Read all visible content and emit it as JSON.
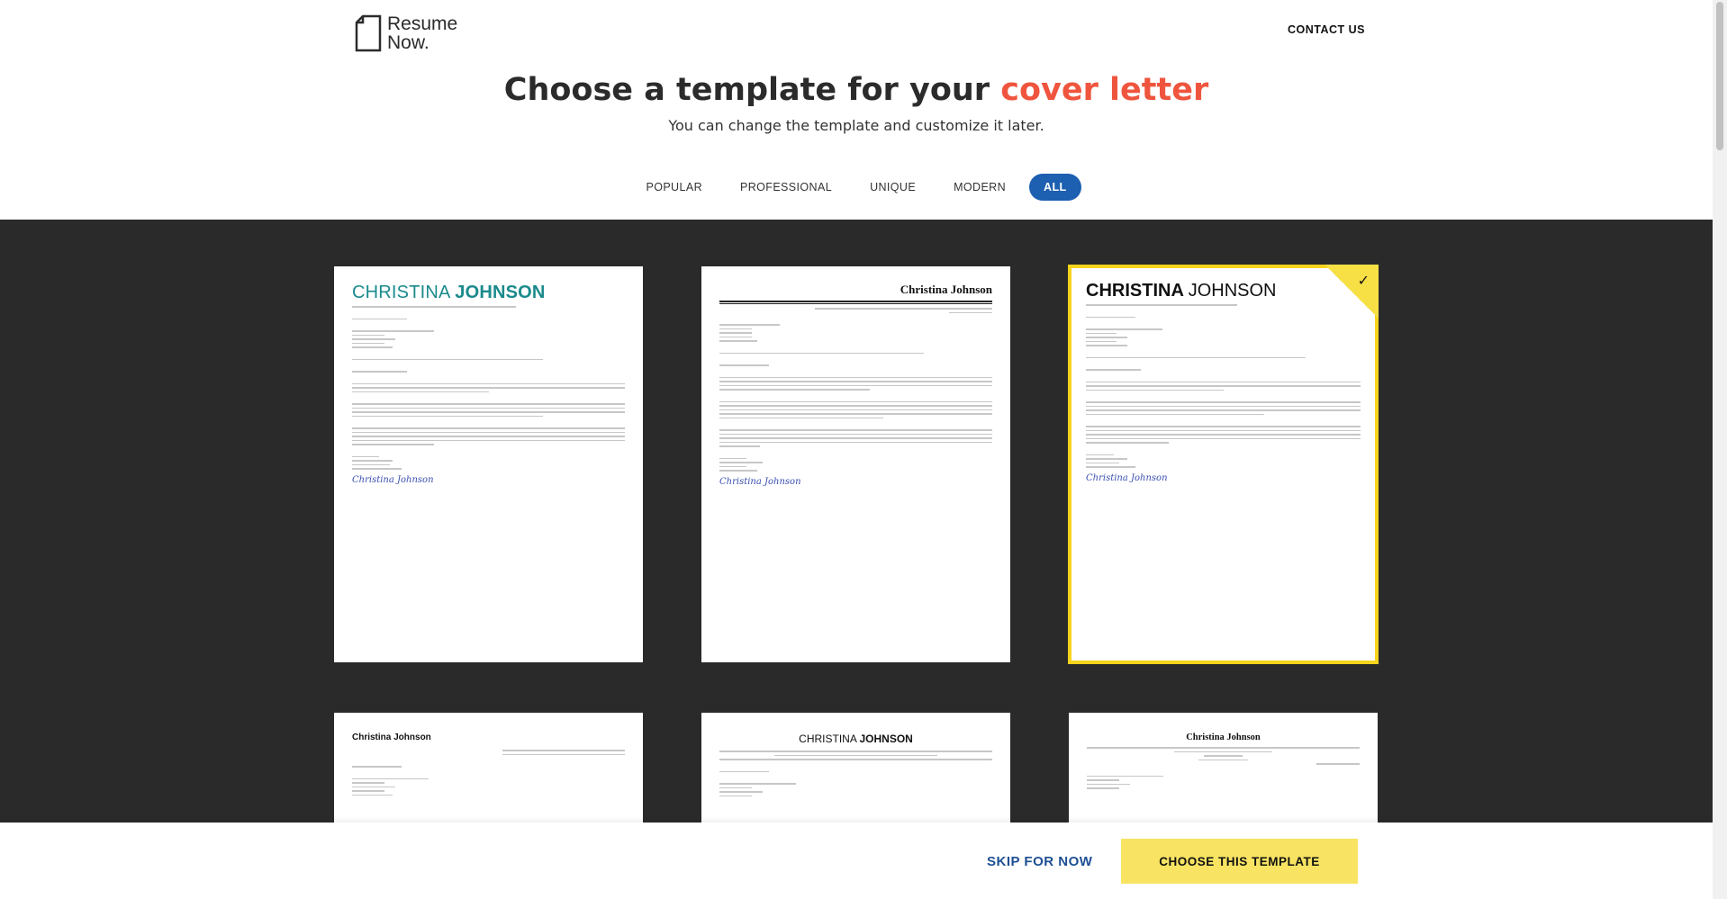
{
  "header": {
    "logo_line1": "Resume",
    "logo_line2": "Now.",
    "contact_label": "CONTACT US",
    "title_main": "Choose a template for your ",
    "title_accent": "cover letter",
    "subtitle": "You can change the template and customize it later."
  },
  "filters": [
    {
      "label": "POPULAR",
      "active": false
    },
    {
      "label": "PROFESSIONAL",
      "active": false
    },
    {
      "label": "UNIQUE",
      "active": false
    },
    {
      "label": "MODERN",
      "active": false
    },
    {
      "label": "ALL",
      "active": true
    }
  ],
  "templates": {
    "t1": {
      "first": "CHRISTINA ",
      "last": "JOHNSON",
      "signature": "Christina Johnson"
    },
    "t2": {
      "name": "Christina Johnson",
      "signature": "Christina Johnson"
    },
    "t3": {
      "first": "CHRISTINA ",
      "last": "JOHNSON",
      "signature": "Christina Johnson",
      "check": "✓"
    },
    "t4": {
      "name": "Christina Johnson"
    },
    "t5": {
      "first": "CHRISTINA ",
      "last": "JOHNSON"
    },
    "t6": {
      "name": "Christina Johnson"
    }
  },
  "footer": {
    "skip_label": "SKIP FOR NOW",
    "choose_label": "CHOOSE THIS TEMPLATE"
  },
  "colors": {
    "accent": "#ef553e",
    "primary_blue": "#1d5fb0",
    "cta_yellow": "#f8e462",
    "gallery_bg": "#2a2a2a"
  }
}
